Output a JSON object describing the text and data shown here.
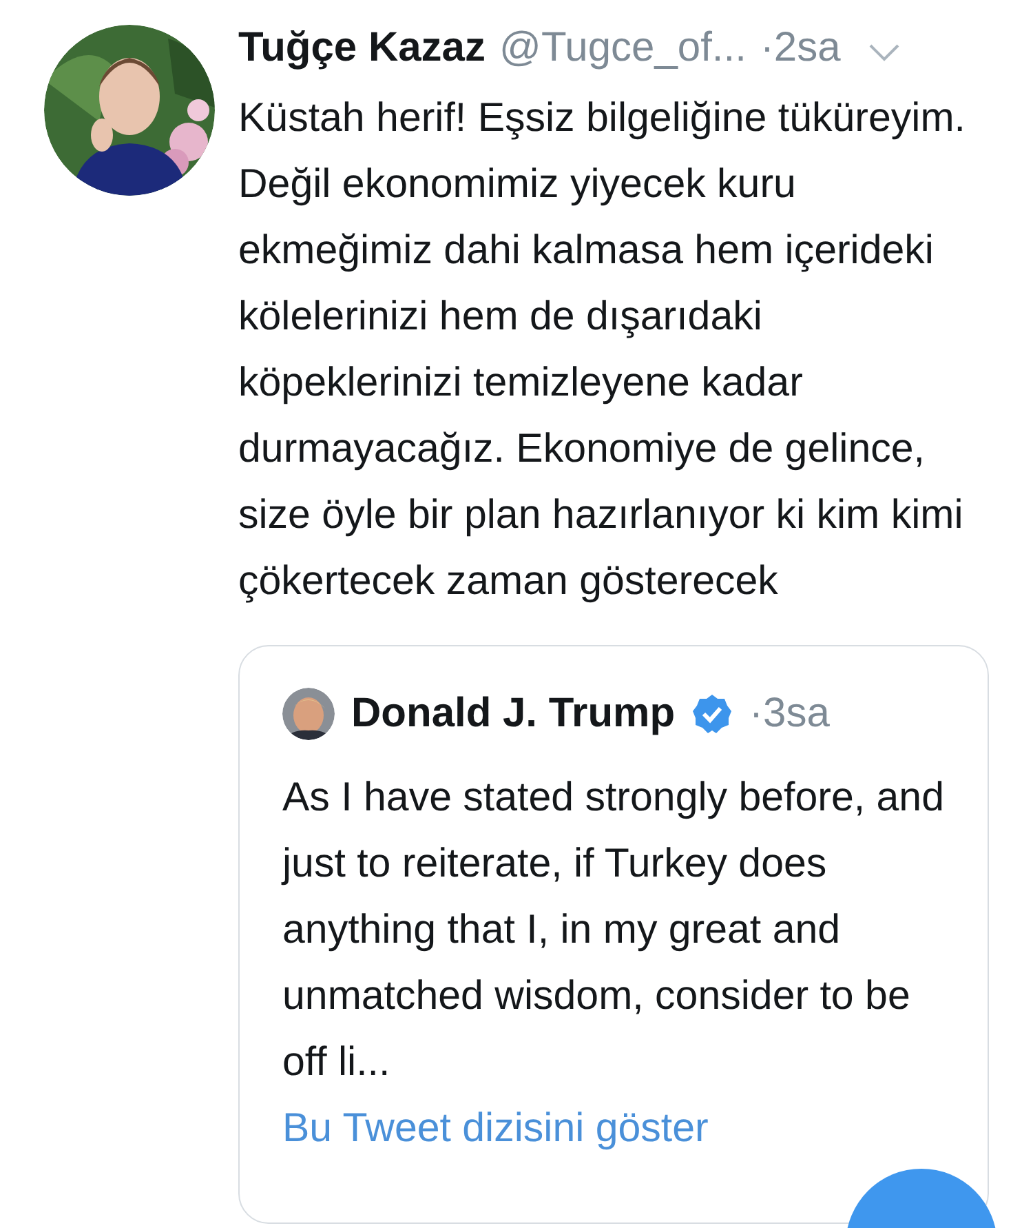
{
  "tweet": {
    "author": {
      "name": "Tuğçe Kazaz",
      "handle": "@Tugce_of...",
      "time": "·2sa"
    },
    "text": "Küstah herif! Eşsiz bilgeliğine tüküreyim. Değil ekonomimiz yiyecek kuru ekmeğimiz dahi kalmasa hem içerideki kölelerinizi hem de dışarıdaki köpeklerinizi temizleyene kadar durmayacağız. Ekonomiye de gelince, size öyle bir plan hazırlanıyor ki kim kimi çökertecek zaman gösterecek",
    "quoted": {
      "author": {
        "name": "Donald J. Trump",
        "verified": true,
        "time": "·3sa"
      },
      "text": "As I have stated strongly before, and just to reiterate, if Turkey does anything that I, in my great and unmatched wisdom, consider to be off li...",
      "link": "Bu Tweet dizisini göster"
    }
  }
}
